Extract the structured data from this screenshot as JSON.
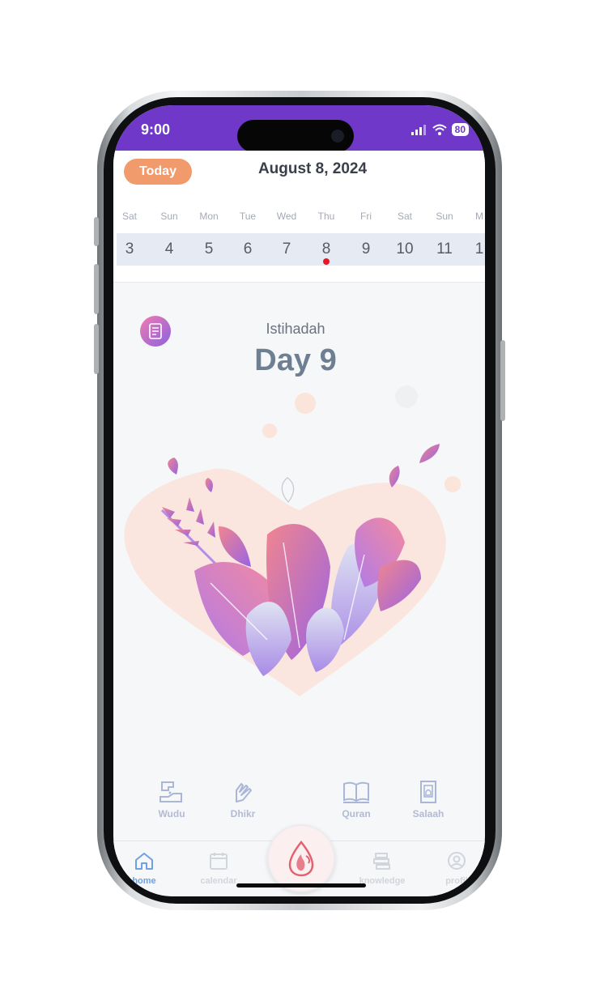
{
  "status_bar": {
    "time": "9:00",
    "battery": "80"
  },
  "header": {
    "today_button": "Today",
    "date_title": "August 8, 2024",
    "weekdays": [
      "Sat",
      "Sun",
      "Mon",
      "Tue",
      "Wed",
      "Thu",
      "Fri",
      "Sat",
      "Sun",
      "M"
    ],
    "dates": [
      "3",
      "4",
      "5",
      "6",
      "7",
      "8",
      "9",
      "10",
      "11",
      "1"
    ],
    "selected_date": "8"
  },
  "main": {
    "status_label": "Istihadah",
    "day_label": "Day 9"
  },
  "actions": [
    {
      "label": "Wudu",
      "icon": "wudu-hand-tap-icon"
    },
    {
      "label": "Dhikr",
      "icon": "dhikr-hands-icon"
    },
    {
      "label": "Quran",
      "icon": "quran-book-icon"
    },
    {
      "label": "Salaah",
      "icon": "prayer-mat-icon"
    }
  ],
  "tabbar": {
    "items": [
      {
        "label": "home",
        "icon": "home-icon",
        "active": true
      },
      {
        "label": "calendar",
        "icon": "calendar-icon",
        "active": false
      },
      {
        "label": "knowledge",
        "icon": "books-icon",
        "active": false
      },
      {
        "label": "profil",
        "icon": "profile-icon",
        "active": false
      }
    ],
    "center_button_icon": "blood-drop-icon"
  },
  "colors": {
    "status_bar": "#6f38c9",
    "today_button": "#f19a6c",
    "today_dot": "#e5182a",
    "active_tab": "#6fa0e4",
    "action_icon": "#a9b6d8"
  }
}
